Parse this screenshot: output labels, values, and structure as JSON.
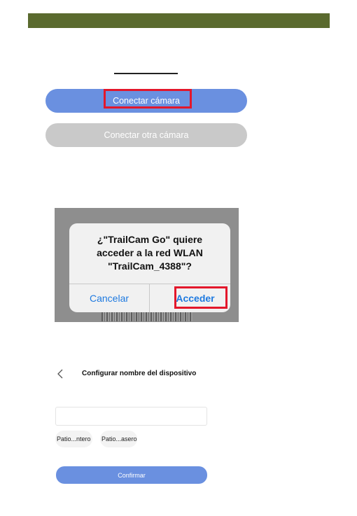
{
  "colors": {
    "header_bar": "#5a6a2e",
    "primary_button": "#6a90e0",
    "secondary_button": "#c9c9c9",
    "highlight": "#e3172b",
    "dialog_link": "#1f7ae0"
  },
  "connect": {
    "primary_label": "Conectar cámara",
    "secondary_label": "Conectar otra cámara"
  },
  "wlan_dialog": {
    "line1": "¿\"TrailCam Go\" quiere",
    "line2": "acceder a la red WLAN",
    "line3": "\"TrailCam_4388\"?",
    "cancel_label": "Cancelar",
    "accept_label": "Acceder"
  },
  "device_name": {
    "back_icon": "chevron-left-icon",
    "title": "Configurar nombre del dispositivo",
    "input_value": "",
    "input_placeholder": "",
    "suggestions": [
      "Patio...ntero",
      "Patio...asero"
    ],
    "confirm_label": "Confirmar"
  }
}
